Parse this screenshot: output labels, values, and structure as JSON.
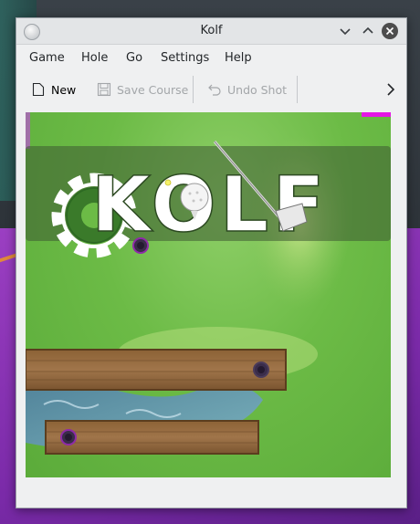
{
  "window": {
    "title": "Kolf"
  },
  "menubar": {
    "items": [
      "Game",
      "Hole",
      "Go",
      "Settings",
      "Help"
    ]
  },
  "toolbar": {
    "new_label": "New",
    "save_course_label": "Save Course",
    "undo_shot_label": "Undo Shot"
  },
  "banner": {
    "text": "KOLF"
  },
  "colors": {
    "grass": "#6cbb46",
    "wall": "#8a6138",
    "water": "#5e8fb0",
    "hole_ring": "#8e2aa8",
    "corner_marker": "#e415e4"
  }
}
